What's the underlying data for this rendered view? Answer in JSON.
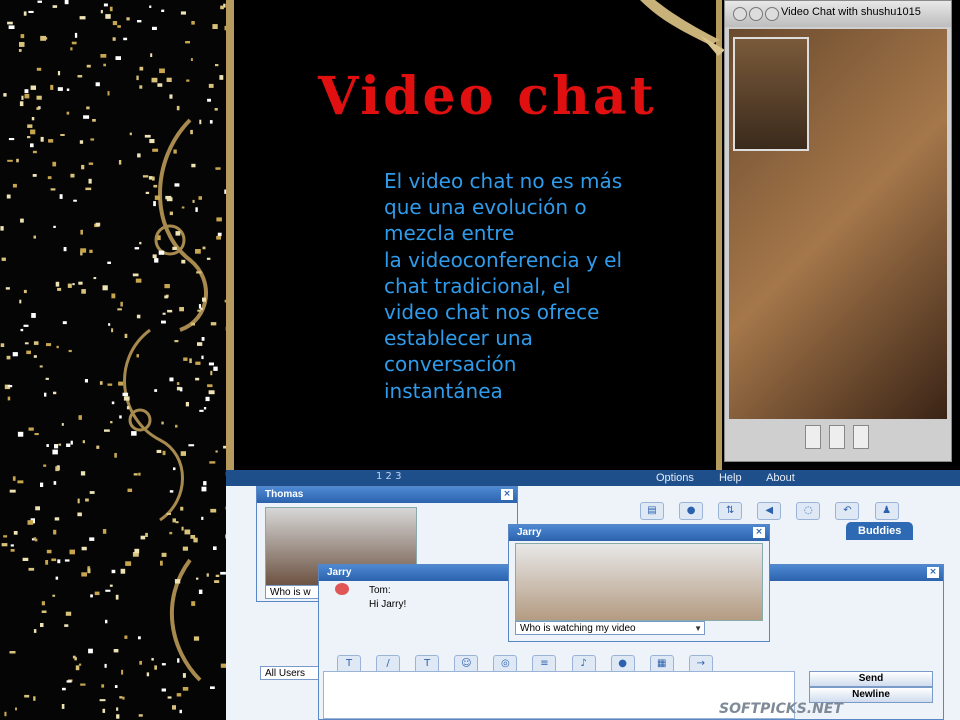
{
  "slide": {
    "title": "Video chat",
    "body_lines": [
      "El video chat no es más",
      "que una evolución o",
      "mezcla entre",
      "la videoconferencia y el",
      "chat tradicional,  el",
      "video chat   nos ofrece",
      "establecer una",
      "conversación",
      "instantánea"
    ]
  },
  "video_chat_window": {
    "title": "Video Chat with shushu1015"
  },
  "im_app": {
    "logo_text": "1 2 3",
    "menu": [
      "Options",
      "Help",
      "About"
    ],
    "tab_buddies": "Buddies",
    "users_dropdown": "All Users",
    "thomas_window": {
      "title": "Thomas",
      "dropdown": "Who is w"
    },
    "jarry_video_window": {
      "title": "Jarry",
      "dropdown": "Who is watching my video"
    },
    "chat_window": {
      "title": "Jarry",
      "sender": "Tom:",
      "message": "Hi Jarry!",
      "send_label": "Send",
      "newline_label": "Newline"
    },
    "watermark": "SOFTPICKS.NET"
  },
  "colors": {
    "title_red": "#e01010",
    "body_blue": "#2f9bea",
    "frame_gold": "#b79a5e",
    "im_blue": "#2c62ad"
  }
}
